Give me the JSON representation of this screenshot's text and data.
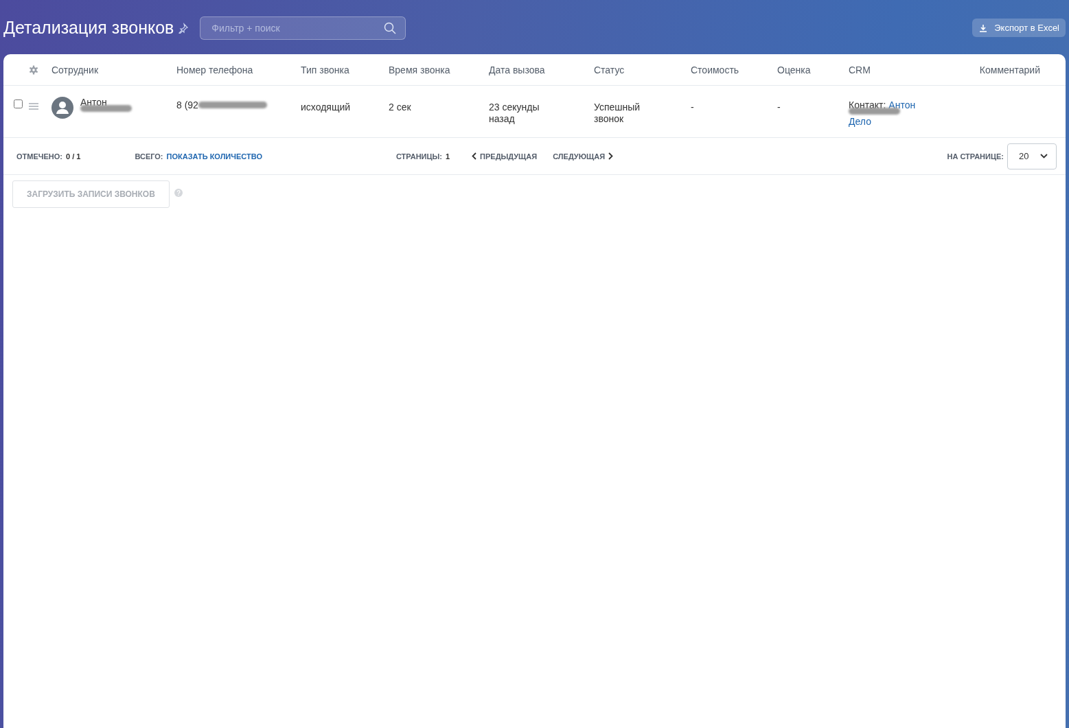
{
  "page": {
    "title": "Детализация звонков"
  },
  "search": {
    "placeholder": "Фильтр + поиск"
  },
  "export_button": {
    "label": "Экспорт в Excel"
  },
  "table": {
    "columns": [
      {
        "label": "Сотрудник"
      },
      {
        "label": "Номер телефона"
      },
      {
        "label": "Тип звонка"
      },
      {
        "label": "Время звонка"
      },
      {
        "label": "Дата вызова"
      },
      {
        "label": "Статус"
      },
      {
        "label": "Стоимость"
      },
      {
        "label": "Оценка"
      },
      {
        "label": "CRM"
      },
      {
        "label": "Комментарий"
      }
    ],
    "rows": [
      {
        "checked": false,
        "redacted": true,
        "employee": "Антон",
        "phone": "8 (92",
        "call_type": "исходящий",
        "duration": "2 сек",
        "call_date": "23 секунды назад",
        "status": "Успешный звонок",
        "cost": "-",
        "rating": "-",
        "crm": {
          "label": "Контакт:",
          "contact": "Антон",
          "deal": "Дело"
        }
      }
    ]
  },
  "footer": {
    "checked_label": "ОТМЕЧЕНО:",
    "checked_value": "0 / 1",
    "total_label": "ВСЕГО:",
    "total_link": "ПОКАЗАТЬ КОЛИЧЕСТВО",
    "pages_label": "СТРАНИЦЫ:",
    "pages_value": "1",
    "prev": "ПРЕДЫДУЩАЯ",
    "next": "СЛЕДУЮЩАЯ",
    "per_page_label": "НА СТРАНИЦЕ:",
    "per_page": "20"
  },
  "load_button": {
    "label": "ЗАГРУЗИТЬ ЗАПИСИ ЗВОНКОВ",
    "disabled": true
  }
}
